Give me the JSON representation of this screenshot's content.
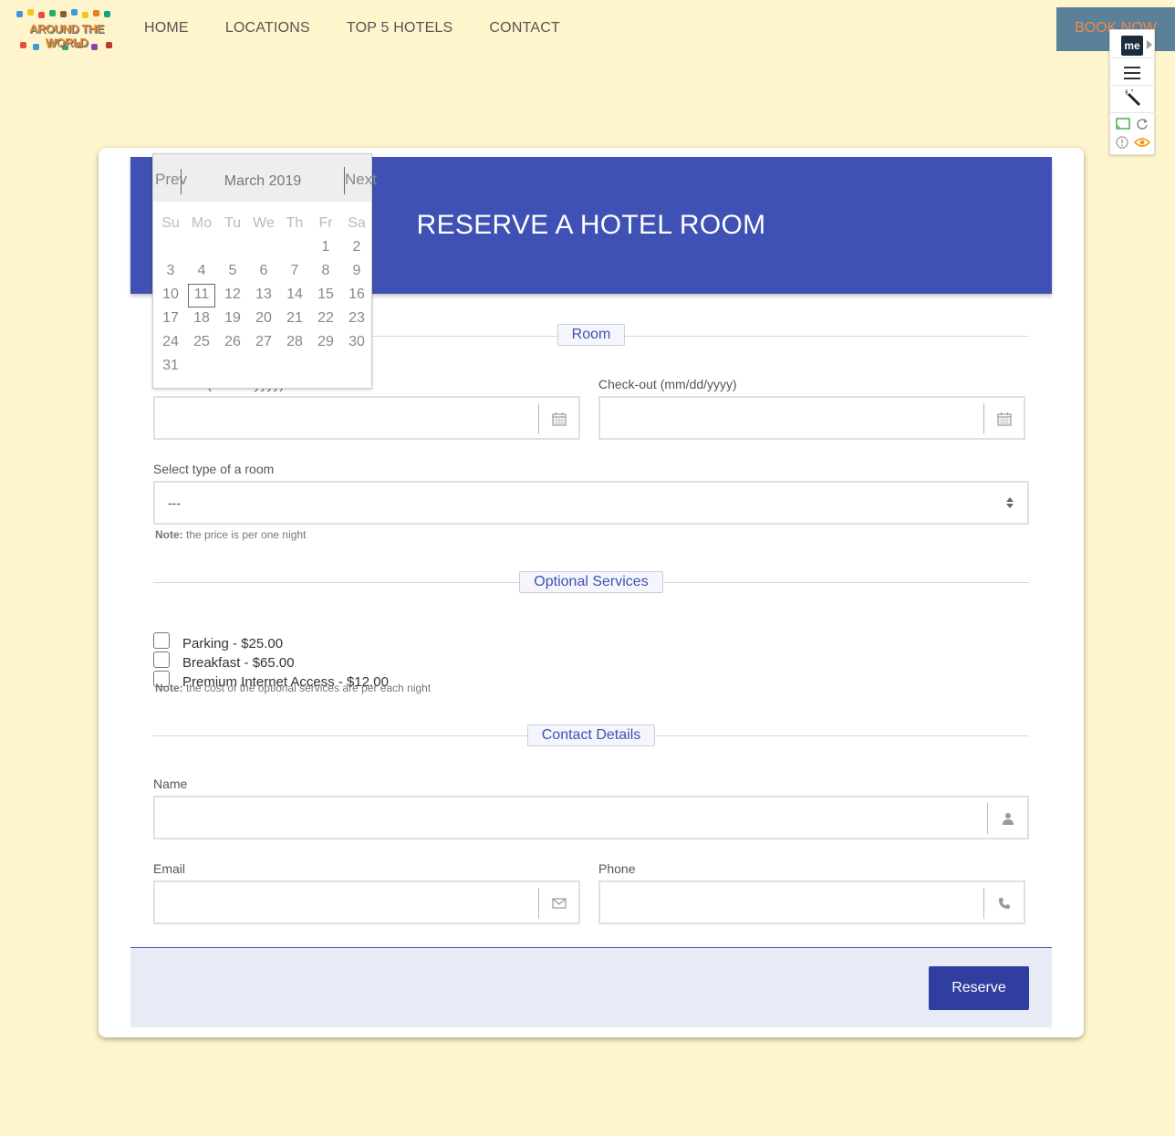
{
  "logo": {
    "text": "AROUND THE WORLD"
  },
  "nav": {
    "items": [
      {
        "label": "HOME"
      },
      {
        "label": "LOCATIONS"
      },
      {
        "label": "TOP 5 HOTELS"
      },
      {
        "label": "CONTACT"
      }
    ],
    "book_now": "BOOK NOW"
  },
  "extension": {
    "badge": "me"
  },
  "form": {
    "title": "RESERVE A HOTEL ROOM",
    "sections": {
      "room": "Room",
      "optional": "Optional Services",
      "contact": "Contact Details"
    },
    "checkin_label": "Check-in (mm/dd/yyyy)",
    "checkout_label": "Check-out (mm/dd/yyyy)",
    "room_type_label": "Select type of a room",
    "room_type_value": "---",
    "room_note_bold": "Note:",
    "room_note": " the price is per one night",
    "services": [
      {
        "label": "Parking - $25.00"
      },
      {
        "label": "Breakfast - $65.00"
      },
      {
        "label": "Premium Internet Access - $12.00"
      }
    ],
    "services_note_bold": "Note:",
    "services_note": " the cost of the optional services are per each night",
    "name_label": "Name",
    "email_label": "Email",
    "phone_label": "Phone",
    "reserve": "Reserve"
  },
  "datepicker": {
    "prev": "Prev",
    "next": "Next",
    "month": "March 2019",
    "weekdays": [
      "Su",
      "Mo",
      "Tu",
      "We",
      "Th",
      "Fr",
      "Sa"
    ],
    "weeks": [
      [
        "",
        "",
        "",
        "",
        "",
        "1",
        "2"
      ],
      [
        "3",
        "4",
        "5",
        "6",
        "7",
        "8",
        "9"
      ],
      [
        "10",
        "11",
        "12",
        "13",
        "14",
        "15",
        "16"
      ],
      [
        "17",
        "18",
        "19",
        "20",
        "21",
        "22",
        "23"
      ],
      [
        "24",
        "25",
        "26",
        "27",
        "28",
        "29",
        "30"
      ],
      [
        "31",
        "",
        "",
        "",
        "",
        "",
        ""
      ]
    ],
    "highlighted": "11"
  },
  "colors": {
    "background": "#fff5cc",
    "primary": "#3f51b5",
    "button": "#303f9f",
    "accent": "#f08a4a"
  }
}
